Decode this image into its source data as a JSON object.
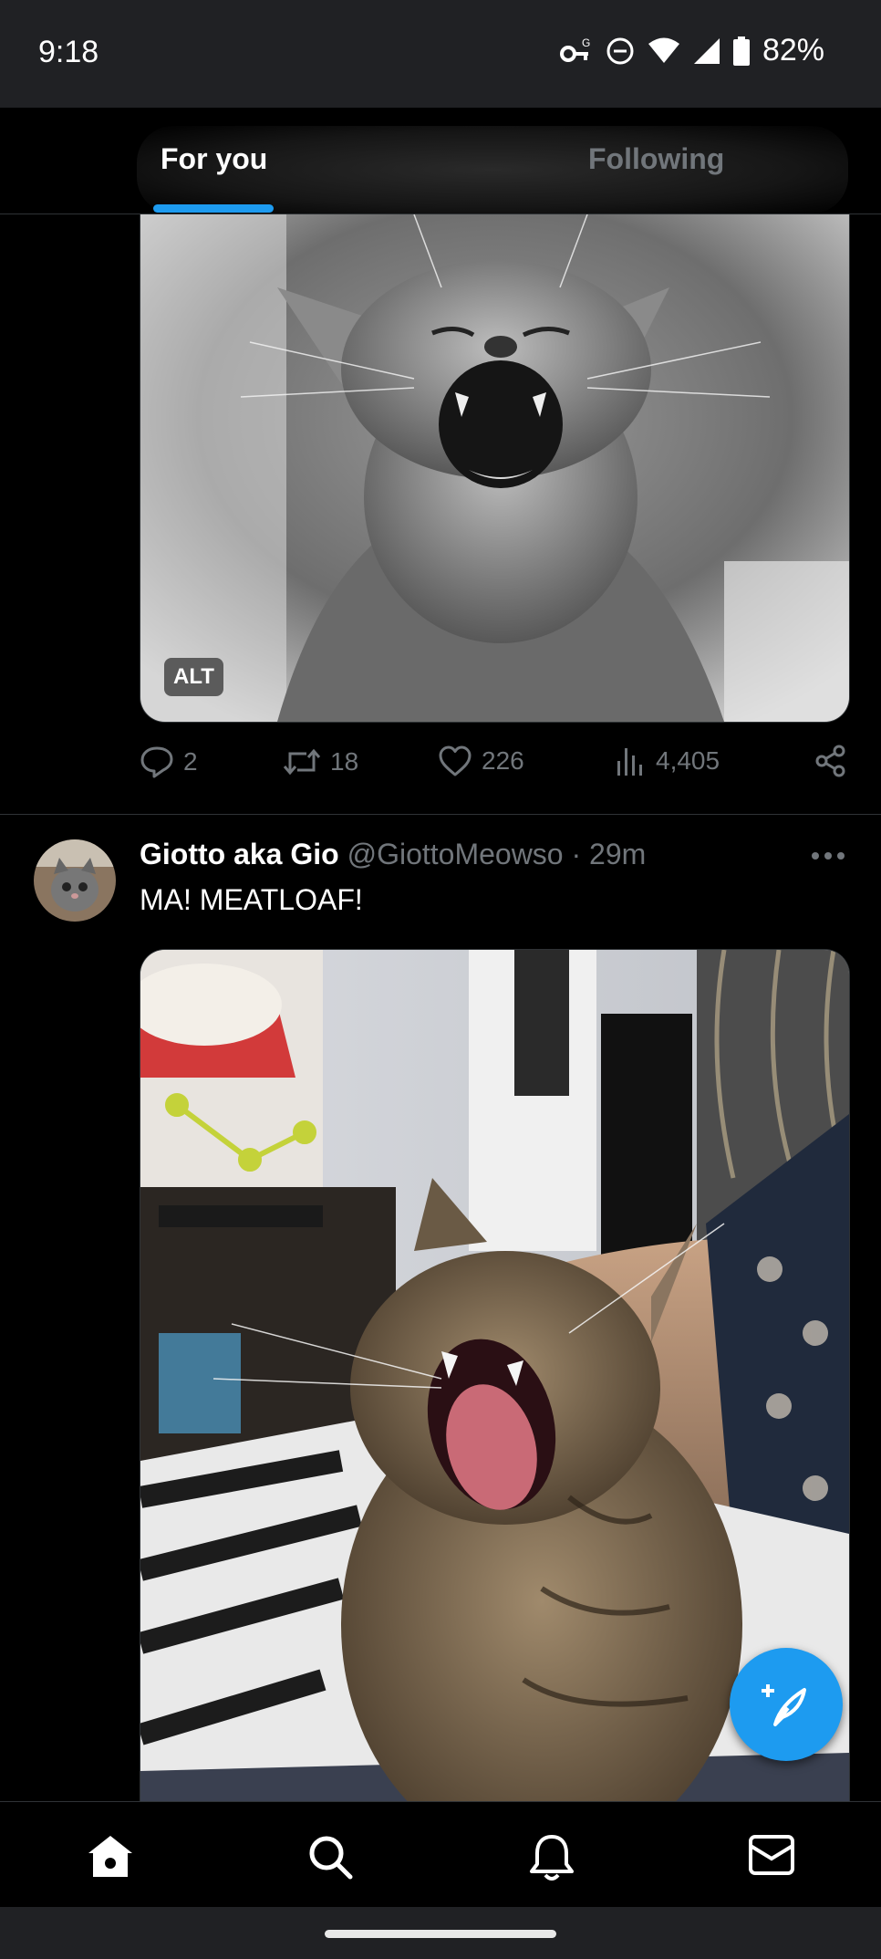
{
  "status_bar": {
    "time": "9:18",
    "battery": "82%",
    "icons": [
      "vpn-key-icon",
      "do-not-disturb-icon",
      "wifi-icon",
      "signal-icon",
      "battery-icon"
    ]
  },
  "tabs": [
    {
      "label": "For you",
      "selected": true
    },
    {
      "label": "Following",
      "selected": false
    }
  ],
  "post1": {
    "alt_badge": "ALT",
    "media_icon": "yawning-kitten-bw-photo",
    "stats": {
      "replies": "2",
      "reposts": "18",
      "likes": "226",
      "views": "4,405"
    }
  },
  "post2": {
    "author_name": "Giotto aka Gio",
    "handle": "@GiottoMeowso",
    "separator": "·",
    "time": "29m",
    "text": "MA! MEATLOAF!",
    "media_icon": "yawning-tabby-kitten-photo"
  },
  "fab_icon": "compose-post-icon",
  "bottom_nav": [
    "home-icon",
    "search-icon",
    "notifications-icon",
    "messages-icon"
  ],
  "colors": {
    "accent": "#1d9bf0",
    "background": "#000000",
    "muted_text": "#71767b",
    "system_bar": "#202124"
  }
}
